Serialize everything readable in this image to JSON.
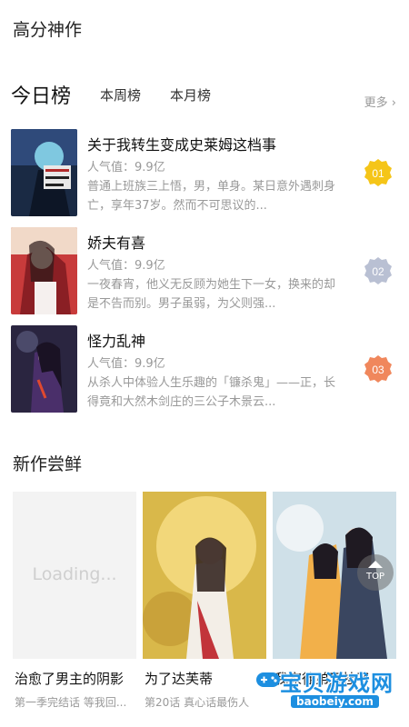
{
  "header": {
    "title": "高分神作"
  },
  "ranking": {
    "title": "今日榜",
    "tabs": [
      "本周榜",
      "本月榜"
    ],
    "more": "更多",
    "items": [
      {
        "rank": "01",
        "title": "关于我转生变成史莱姆这档事",
        "popularity": "人气值：9.9亿",
        "desc": "普通上班族三上悟，男，单身。某日意外遇刺身亡，享年37岁。然而不可思议的...",
        "badge_color": "#f5c518"
      },
      {
        "rank": "02",
        "title": "娇夫有喜",
        "popularity": "人气值：9.9亿",
        "desc": "一夜春宵，他义无反顾为她生下一女，换来的却是不告而别。男子虽弱，为父则强...",
        "badge_color": "#b9c0d3"
      },
      {
        "rank": "03",
        "title": "怪力乱神",
        "popularity": "人气值：9.9亿",
        "desc": "从杀人中体验人生乐趣的「镰杀鬼」——正，长得竟和大然木剑庄的三公子木景云...",
        "badge_color": "#f0875c"
      }
    ]
  },
  "new_works": {
    "title": "新作尝鲜",
    "loading_text": "Loading...",
    "cards": [
      {
        "title": "治愈了男主的阴影",
        "sub": "第一季完结话 等我回..."
      },
      {
        "title": "为了达芙蒂",
        "sub": "第20话 真心话最伤人"
      },
      {
        "title": "我家徒弟又挂了",
        "sub": ""
      }
    ]
  },
  "top_button": {
    "label": "TOP"
  },
  "watermark": {
    "main": "宝贝游戏网",
    "sub": "baobeiy.com"
  }
}
